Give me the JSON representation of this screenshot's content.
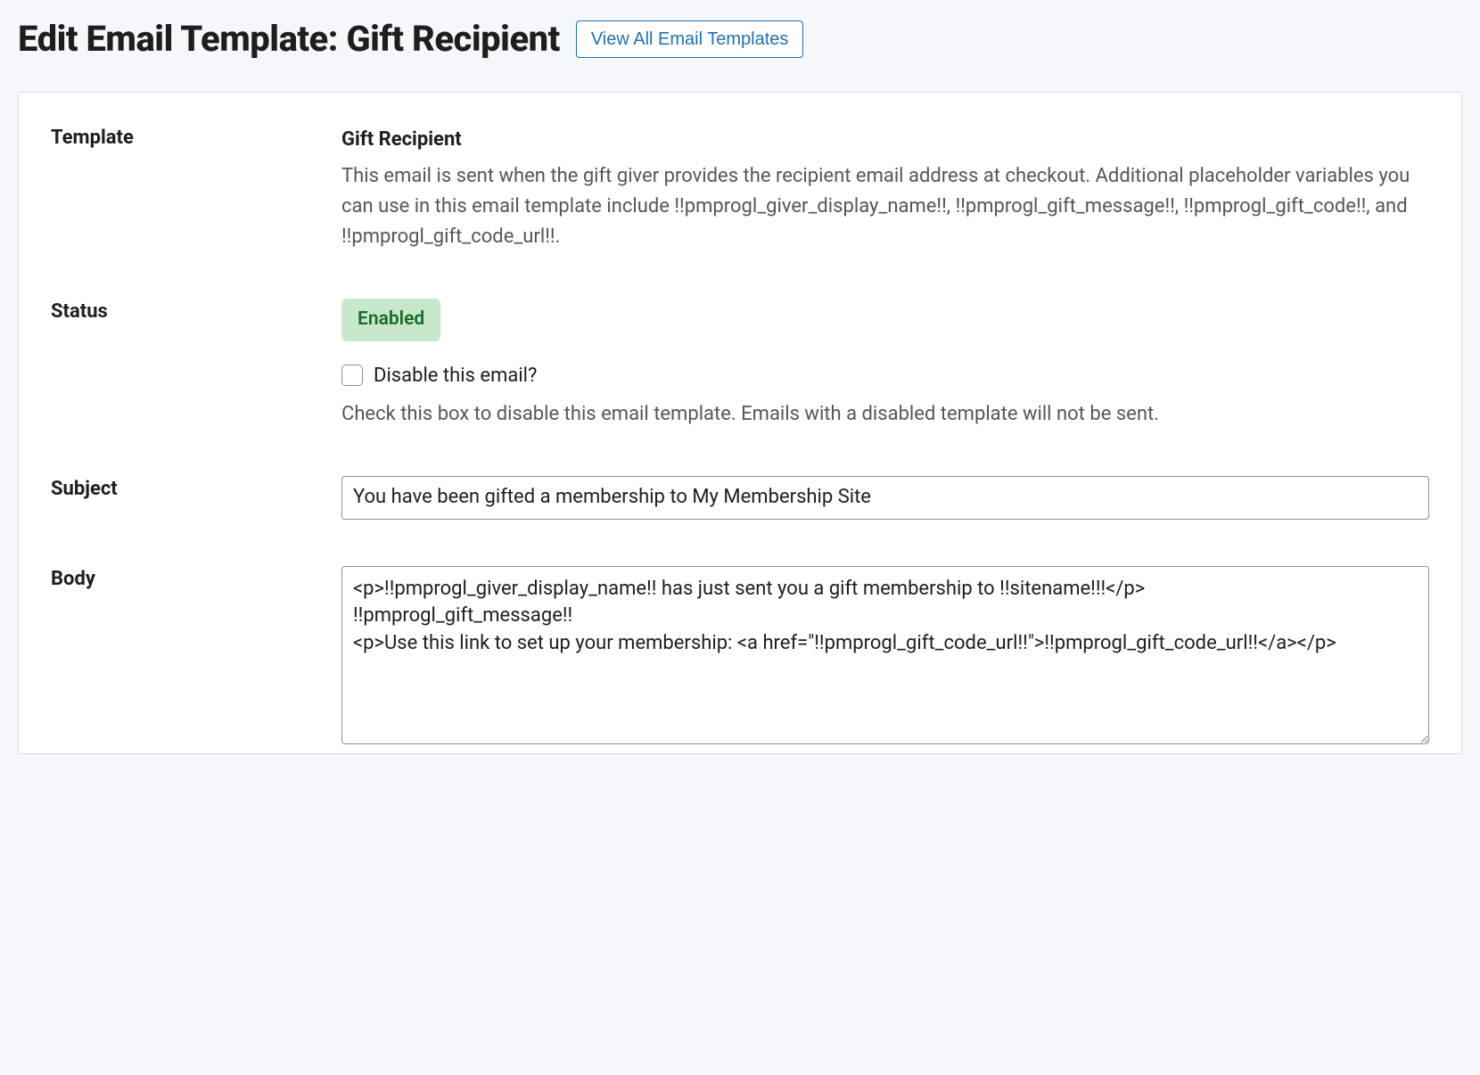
{
  "header": {
    "title": "Edit Email Template: Gift Recipient",
    "view_all_label": "View All Email Templates"
  },
  "rows": {
    "template": {
      "label": "Template",
      "name": "Gift Recipient",
      "description": "This email is sent when the gift giver provides the recipient email address at checkout. Additional placeholder variables you can use in this email template include !!pmprogl_giver_display_name!!, !!pmprogl_gift_message!!, !!pmprogl_gift_code!!, and !!pmprogl_gift_code_url!!."
    },
    "status": {
      "label": "Status",
      "badge": "Enabled",
      "checkbox_label": "Disable this email?",
      "checkbox_checked": false,
      "help_text": "Check this box to disable this email template. Emails with a disabled template will not be sent."
    },
    "subject": {
      "label": "Subject",
      "value": "You have been gifted a membership to My Membership Site"
    },
    "body": {
      "label": "Body",
      "value": "<p>!!pmprogl_giver_display_name!! has just sent you a gift membership to !!sitename!!!</p>\n!!pmprogl_gift_message!!\n<p>Use this link to set up your membership: <a href=\"!!pmprogl_gift_code_url!!\">!!pmprogl_gift_code_url!!</a></p>"
    }
  }
}
